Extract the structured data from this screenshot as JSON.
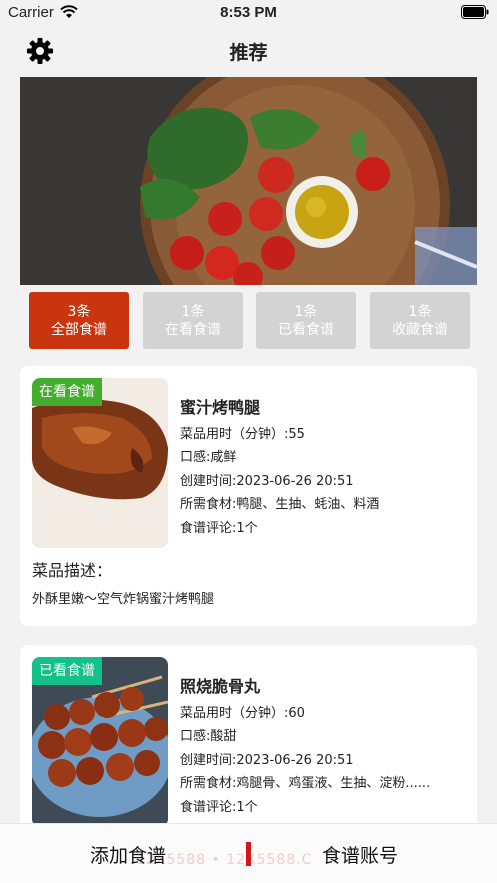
{
  "status_bar": {
    "carrier": "Carrier",
    "time": "8:53 PM"
  },
  "nav": {
    "title": "推荐",
    "settings_icon": "gear-icon"
  },
  "banner": {
    "alt": "food-banner"
  },
  "filters": [
    {
      "count": "3条",
      "label": "全部食谱",
      "active": true
    },
    {
      "count": "1条",
      "label": "在看食谱",
      "active": false
    },
    {
      "count": "1条",
      "label": "已看食谱",
      "active": false
    },
    {
      "count": "1条",
      "label": "收藏食谱",
      "active": false
    }
  ],
  "recipes": [
    {
      "tag": "在看食谱",
      "title": "蜜汁烤鸭腿",
      "time": "菜品用时（分钟）:55",
      "taste": "口感:咸鲜",
      "created": "创建时间:2023-06-26 20:51",
      "ingredients": "所需食材:鸭腿、生抽、蚝油、料酒",
      "comments": "食谱评论:1个",
      "desc_label": "菜品描述：",
      "desc": "外酥里嫩～空气炸锅蜜汁烤鸭腿"
    },
    {
      "tag": "已看食谱",
      "title": "照烧脆骨丸",
      "time": "菜品用时（分钟）:60",
      "taste": "口感:酸甜",
      "created": "创建时间:2023-06-26 20:51",
      "ingredients": "所需食材:鸡腿骨、鸡蛋液、生抽、淀粉......",
      "comments": "食谱评论:1个"
    }
  ],
  "tab_bar": {
    "left": "添加食谱",
    "right": "食谱账号",
    "watermark": "12X5588 • 12X5588.C"
  },
  "colors": {
    "accent": "#c9350e",
    "tag_green": "#43ad2e",
    "tag_teal": "#14c089",
    "inactive": "#d3d3d3"
  }
}
